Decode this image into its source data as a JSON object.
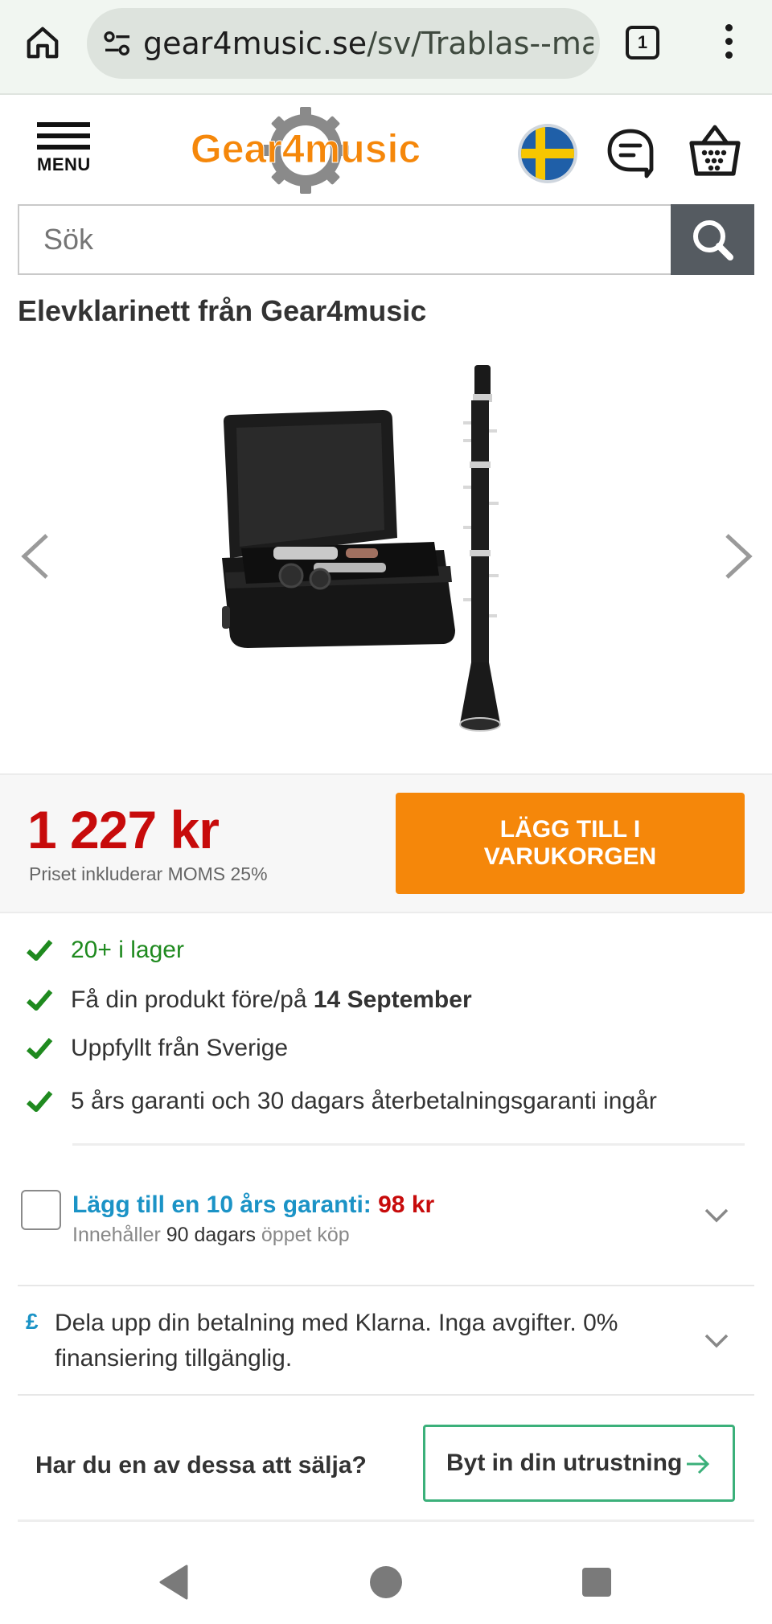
{
  "browser": {
    "url_host": "gear4music.se",
    "url_path": "/sv/Trablas--ma",
    "tab_count": "1"
  },
  "header": {
    "menu_label": "MENU",
    "logo_text": "Gear4music",
    "search_placeholder": "Sök"
  },
  "product": {
    "title": "Elevklarinett från Gear4music",
    "price": "1 227 kr",
    "vat_note": "Priset inkluderar MOMS  25%",
    "add_to_cart": "LÄGG TILL I VARUKORGEN"
  },
  "checklist": [
    {
      "text": "20+ i lager"
    },
    {
      "text_before": "Få din produkt före/på ",
      "text_bold": "14 September"
    },
    {
      "text": "Uppfyllt från Sverige"
    },
    {
      "text": "5 års garanti och 30 dagars återbetalningsgaranti ingår"
    }
  ],
  "warranty": {
    "title": "Lägg till en 10 års garanti: ",
    "amount": "98 kr",
    "sub_before": "Innehåller ",
    "sub_bold": "90 dagars",
    "sub_after": " öppet köp"
  },
  "klarna": {
    "symbol": "£",
    "text": "Dela upp din betalning med Klarna. Inga avgifter. 0% finansiering tillgänglig."
  },
  "tradein": {
    "question": "Har du en av dessa att sälja?",
    "button": "Byt in din utrustning"
  },
  "colors": {
    "brand_orange": "#f5870a",
    "price_red": "#c70b0b",
    "stock_green": "#1f8a1f",
    "link_blue": "#1b93c6",
    "tradein_green": "#3bb07a"
  }
}
